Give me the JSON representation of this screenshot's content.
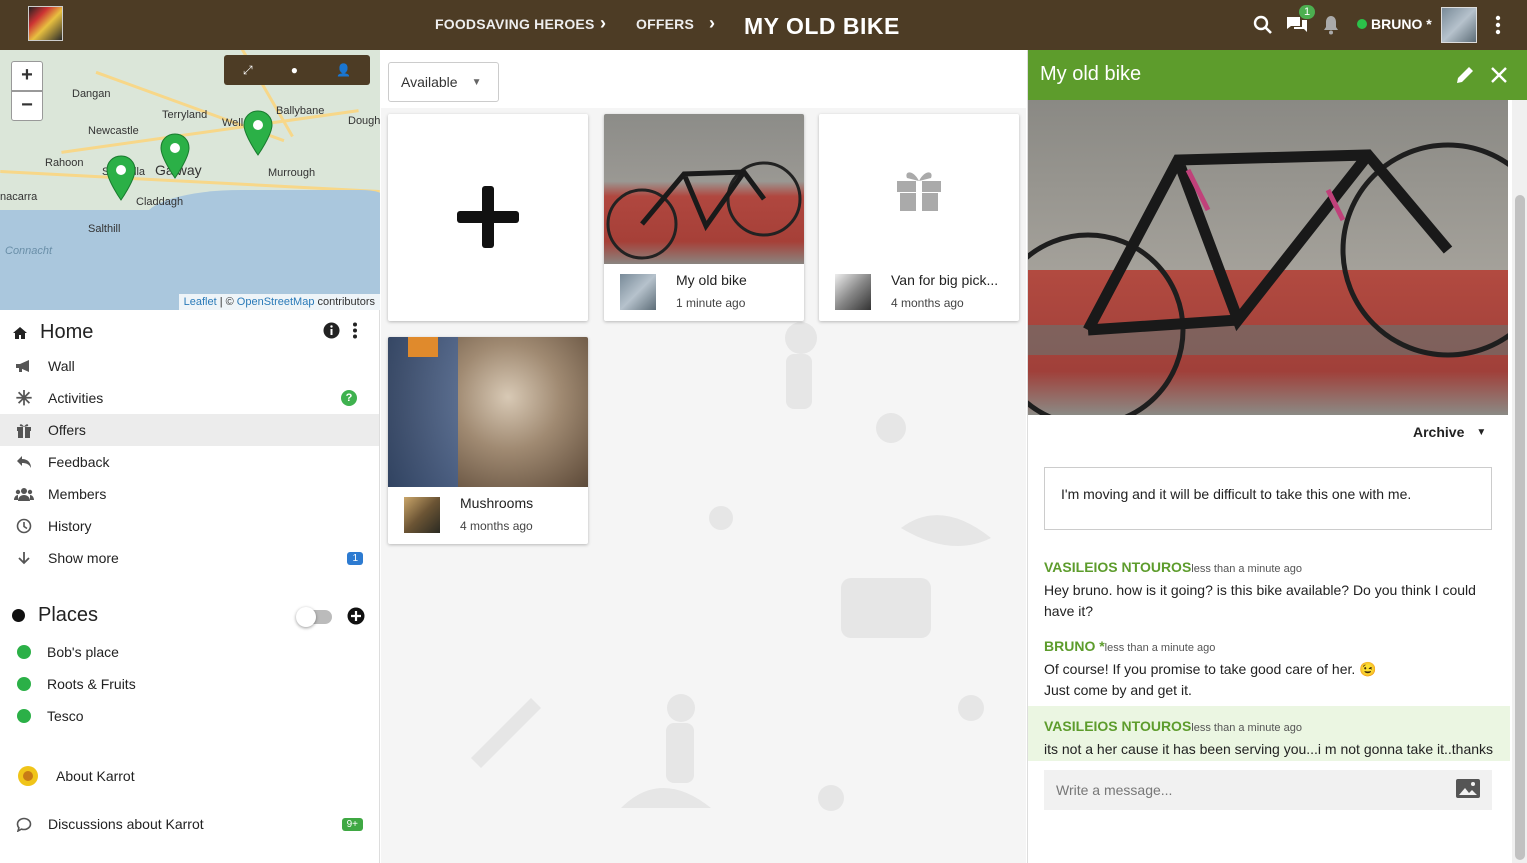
{
  "topbar": {
    "group": "FOODSAVING HEROES",
    "section": "OFFERS",
    "title": "MY OLD BIKE",
    "chat_badge": "1",
    "user": "BRUNO *"
  },
  "map": {
    "towns": [
      "Dangan",
      "Terryland",
      "Ballybane",
      "Newcastle",
      "Well",
      "Dough",
      "Rahoon",
      "Galway",
      "Murrough",
      "Claddagh",
      "nacarra",
      "Salthill",
      "Connacht",
      "Sa",
      "lla"
    ],
    "zoom_in": "+",
    "zoom_out": "−",
    "attribution": {
      "leaflet": "Leaflet",
      "sep": "| ©",
      "osm": "OpenStreetMap",
      "rest": "contributors"
    }
  },
  "sidebar": {
    "home": "Home",
    "items": [
      {
        "label": "Wall"
      },
      {
        "label": "Activities",
        "help": "?"
      },
      {
        "label": "Offers"
      },
      {
        "label": "Feedback"
      },
      {
        "label": "Members"
      },
      {
        "label": "History"
      },
      {
        "label": "Show more",
        "badge": "1"
      }
    ],
    "places_title": "Places",
    "places": [
      "Bob's place",
      "Roots & Fruits",
      "Tesco"
    ],
    "about": "About Karrot",
    "discussions": "Discussions about Karrot",
    "discussions_badge": "9+"
  },
  "offers": {
    "filter": "Available",
    "cards": [
      {
        "title": "My old bike",
        "time": "1 minute ago"
      },
      {
        "title": "Van for big pick...",
        "time": "4 months ago"
      },
      {
        "title": "Mushrooms",
        "time": "4 months ago"
      }
    ]
  },
  "detail": {
    "title": "My old bike",
    "archive": "Archive",
    "description": "I'm moving and it will be difficult to take this one with me.",
    "messages": [
      {
        "author": "VASILEIOS NTOUROS",
        "time": "less than a minute ago",
        "lines": [
          "Hey bruno. how is it going? is this bike available? Do you think I could",
          "have it?"
        ]
      },
      {
        "author": "BRUNO *",
        "time": "less than a minute ago",
        "lines": [
          "Of course! If you promise to take good care of her. 😉",
          "Just come by and get it."
        ]
      },
      {
        "author": "VASILEIOS NTOUROS",
        "time": "less than a minute ago",
        "lines": [
          "its not a her cause it has been serving you...i m not gonna take it..thanks"
        ]
      }
    ],
    "placeholder": "Write a message..."
  },
  "colors": {
    "topbar": "#4d3c25",
    "accent_green": "#5d9c2c",
    "place_dot": "#2bb047",
    "badge_blue": "#2d7bd1"
  },
  "icons": [
    "search-icon",
    "chat-icon",
    "bell-icon",
    "more-vert-icon",
    "home-icon",
    "info-icon",
    "megaphone-icon",
    "asterisk-icon",
    "gift-icon",
    "reply-icon",
    "people-icon",
    "history-icon",
    "arrow-down-icon",
    "add-circle-icon",
    "pencil-icon",
    "close-icon",
    "image-icon",
    "chevron-right-icon",
    "caret-down-icon"
  ]
}
